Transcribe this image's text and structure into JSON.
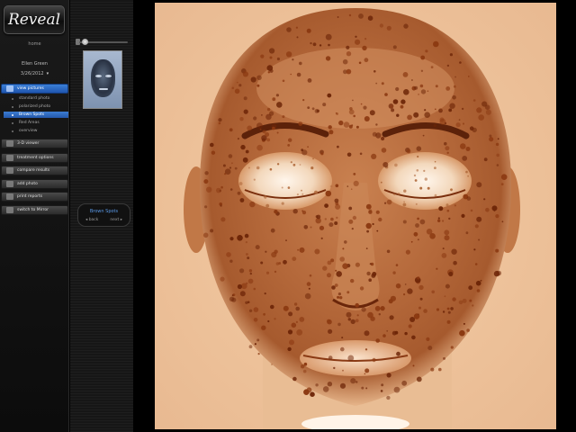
{
  "sidebar": {
    "logo": "Reveal",
    "home": "home",
    "patient_name": "Ellen Green",
    "session_date": "3/26/2012",
    "session_chevron": "▾",
    "nav_primary": [
      {
        "label": "view pictures",
        "icon": "camera-icon",
        "active": true
      }
    ],
    "sub_items": [
      {
        "label": "standard photo",
        "active": false
      },
      {
        "label": "polarized photo",
        "active": false
      },
      {
        "label": "Brown Spots",
        "active": true
      },
      {
        "label": "Red Areas",
        "active": false
      },
      {
        "label": "overview",
        "active": false
      }
    ],
    "nav_secondary": [
      {
        "label": "3-D viewer",
        "icon": "cube-icon"
      },
      {
        "label": "treatment options",
        "icon": "clipboard-icon"
      },
      {
        "label": "compare results",
        "icon": "compare-icon"
      },
      {
        "label": "add photo",
        "icon": "add-photo-icon"
      },
      {
        "label": "print reports",
        "icon": "printer-icon"
      },
      {
        "label": "switch to Mirror",
        "icon": "switch-icon"
      }
    ]
  },
  "thumb_panel": {
    "slider_level": 0.12,
    "view_name": "Brown Spots",
    "back_label": "◂ back",
    "next_label": "next ▸"
  },
  "colors": {
    "accent_blue": "#2f6fc8",
    "spot_dark": "#7a2e0c",
    "skin_base": "#edc199"
  }
}
